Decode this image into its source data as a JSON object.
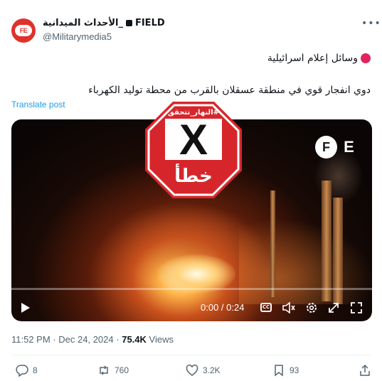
{
  "author": {
    "name_arabic": "الأحداث الميدانية_",
    "name_latin": "FIELD",
    "handle": "@Militarymedia5",
    "avatar_text": "FE"
  },
  "post": {
    "line1": "وسائل إعلام اسرائيلية",
    "line2": "دوي انفجار قوي في منطقة عسقلان بالقرب من محطة توليد الكهرباء",
    "translate_label": "Translate post"
  },
  "video": {
    "watermark_f": "F",
    "watermark_e": "E",
    "time_display": "0:00 / 0:24",
    "progress": 0,
    "cc_label": "CC"
  },
  "stamp": {
    "label": "#النهار_تتحقق",
    "mark": "X",
    "verdict": "خطأ",
    "color": "#d7262b"
  },
  "meta": {
    "time": "11:52 PM",
    "separator": "·",
    "date": "Dec 24, 2024",
    "views_count": "75.4K",
    "views_label": "Views"
  },
  "actions": {
    "replies": "8",
    "reposts": "760",
    "likes": "3.2K",
    "bookmarks": "93"
  },
  "colors": {
    "link": "#1d9bf0",
    "muted": "#536471",
    "accent_dot": "#e0245e"
  }
}
